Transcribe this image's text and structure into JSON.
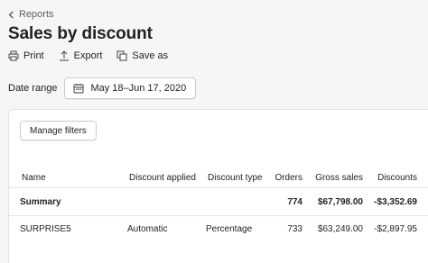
{
  "breadcrumb": {
    "label": "Reports"
  },
  "page": {
    "title": "Sales by discount"
  },
  "actions": {
    "print": "Print",
    "export": "Export",
    "save_as": "Save as"
  },
  "date_range": {
    "label": "Date range",
    "value": "May 18–Jun 17, 2020"
  },
  "filters": {
    "manage_label": "Manage filters"
  },
  "table": {
    "columns": [
      "Name",
      "Discount applied",
      "Discount type",
      "Orders",
      "Gross sales",
      "Discounts"
    ],
    "summary": {
      "name": "Summary",
      "orders": "774",
      "gross_sales": "$67,798.00",
      "discounts": "-$3,352.69"
    },
    "rows": [
      {
        "name": "SURPRISE5",
        "applied": "Automatic",
        "type": "Percentage",
        "orders": "733",
        "gross_sales": "$63,249.00",
        "discounts": "-$2,897.95"
      }
    ]
  }
}
